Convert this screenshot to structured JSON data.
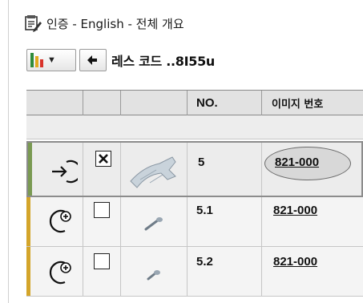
{
  "window": {
    "title": "인증 - English - 전체 개요"
  },
  "toolbar": {
    "chart_bar_colors": [
      "#2e8b3a",
      "#e0a91e",
      "#d8322a"
    ],
    "code_label": "레스 코드 ..8I55u"
  },
  "table": {
    "columns": [
      "",
      "",
      "NO.",
      "이미지 번호"
    ],
    "rows": [
      {
        "icon": "enter-icon",
        "checked": true,
        "no": "5",
        "image_no": "821-000",
        "stripe_color": "#7a9a52",
        "selected": true
      },
      {
        "icon": "add-circle-icon",
        "checked": false,
        "no": "5.1",
        "image_no": "821-000",
        "stripe_color": "#d4a52a",
        "selected": false
      },
      {
        "icon": "add-circle-icon",
        "checked": false,
        "no": "5.2",
        "image_no": "821-000",
        "stripe_color": "#d4a52a",
        "selected": false
      }
    ]
  }
}
